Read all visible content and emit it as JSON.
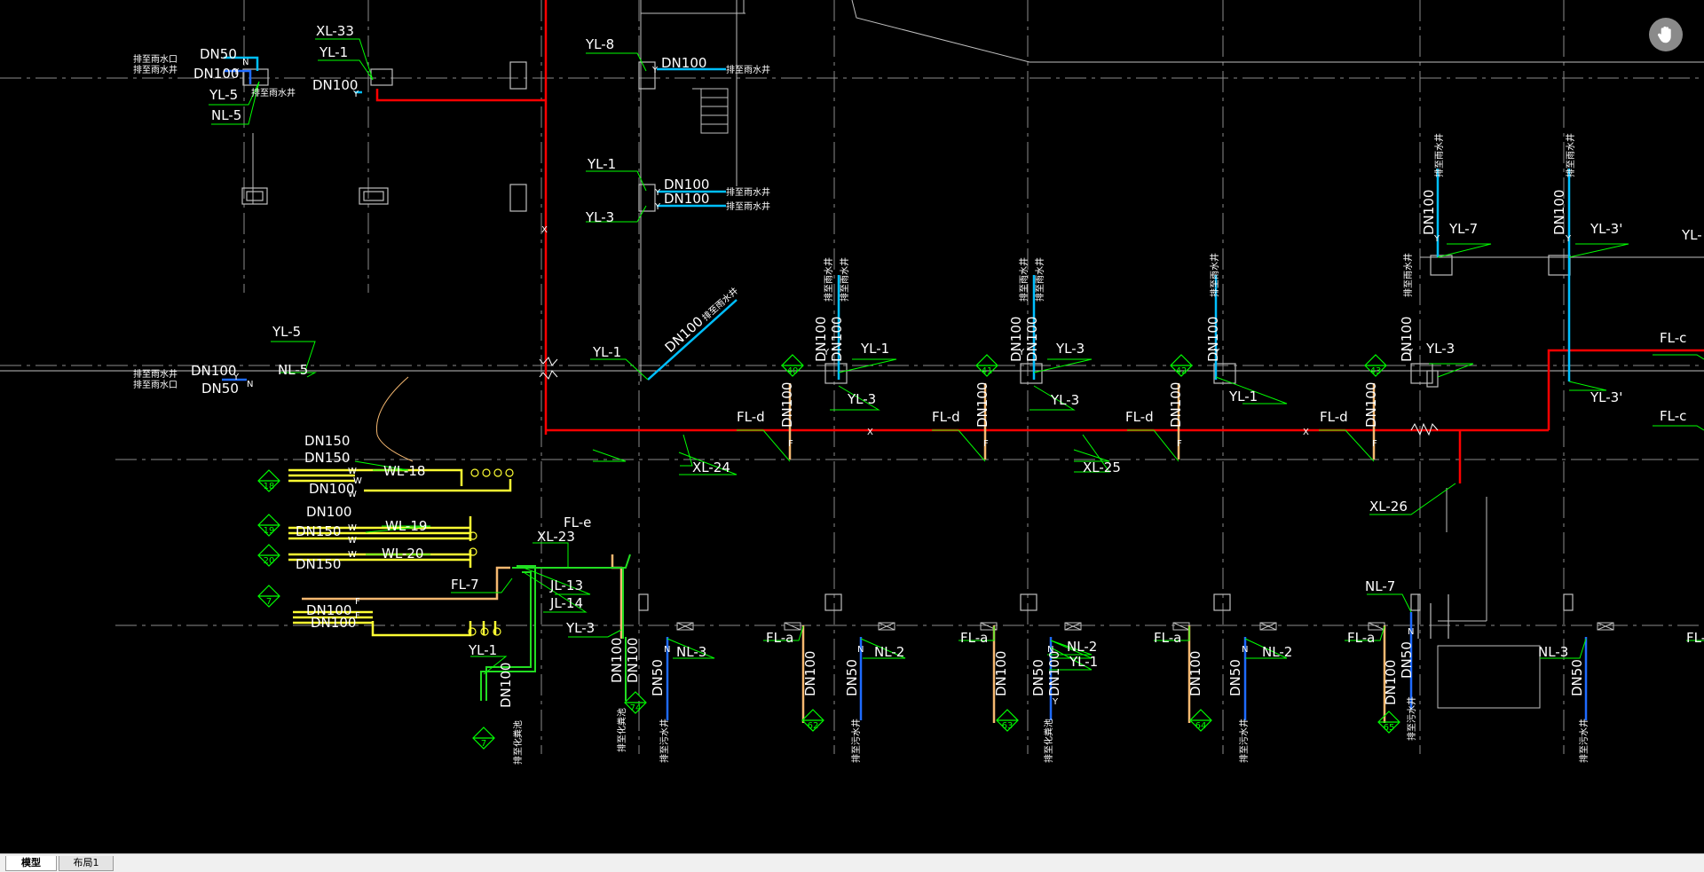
{
  "colors": {
    "background": "#000000",
    "gridline": "#ffffff",
    "wall": "#bfbfbf",
    "pipe_red": "#ff0000",
    "pipe_cyan": "#00bfff",
    "pipe_blue": "#1e6bff",
    "pipe_yellow": "#ffff33",
    "pipe_orange": "#f5b870",
    "pipe_green": "#22dd22",
    "leader_green": "#00ff00",
    "text_white": "#ffffff",
    "tag_green": "#00ff00"
  },
  "icons": {
    "pan": "hand-pan-icon"
  },
  "tabs": [
    {
      "label": "模型",
      "active": true
    },
    {
      "label": "布局1",
      "active": false
    }
  ],
  "labels": {
    "dn50": "DN50",
    "dn100": "DN100",
    "dn150": "DN150",
    "rain_outlet_well": "排至雨水井",
    "rain_outlet_port": "排至雨水口",
    "rain_well": "排至雨水井",
    "yl1": "YL-1",
    "yl3": "YL-3",
    "yl3p": "YL-3'",
    "yl5": "YL-5",
    "yl7": "YL-7",
    "yl8": "YL-8",
    "xl33": "XL-33",
    "xl23": "XL-23",
    "xl24": "XL-24",
    "xl25": "XL-25",
    "xl26": "XL-26",
    "nl2": "NL-2",
    "nl3": "NL-3",
    "nl5": "NL-5",
    "nl7": "NL-7",
    "wl18": "WL-18",
    "wl19": "WL-19",
    "wl20": "WL-20",
    "fld": "FL-d",
    "flc": "FL-c",
    "fla": "FL-a",
    "fle": "FL-e",
    "fl7": "FL-7",
    "jl13": "JL-13",
    "jl14": "JL-14",
    "ylfrag": "YL-",
    "y": "Y",
    "n": "N",
    "w": "W",
    "f": "F",
    "x": "X",
    "sewer": "排至污水井",
    "septic": "排至化粪池"
  },
  "tags": {
    "f40": "40",
    "f41": "41",
    "f42": "42",
    "f43": "43",
    "f62": "62",
    "f63": "63",
    "f64": "64",
    "f65": "65",
    "w18": "18",
    "w19": "19",
    "w20": "20",
    "f7": "7",
    "j7": "7",
    "f74": "74"
  }
}
